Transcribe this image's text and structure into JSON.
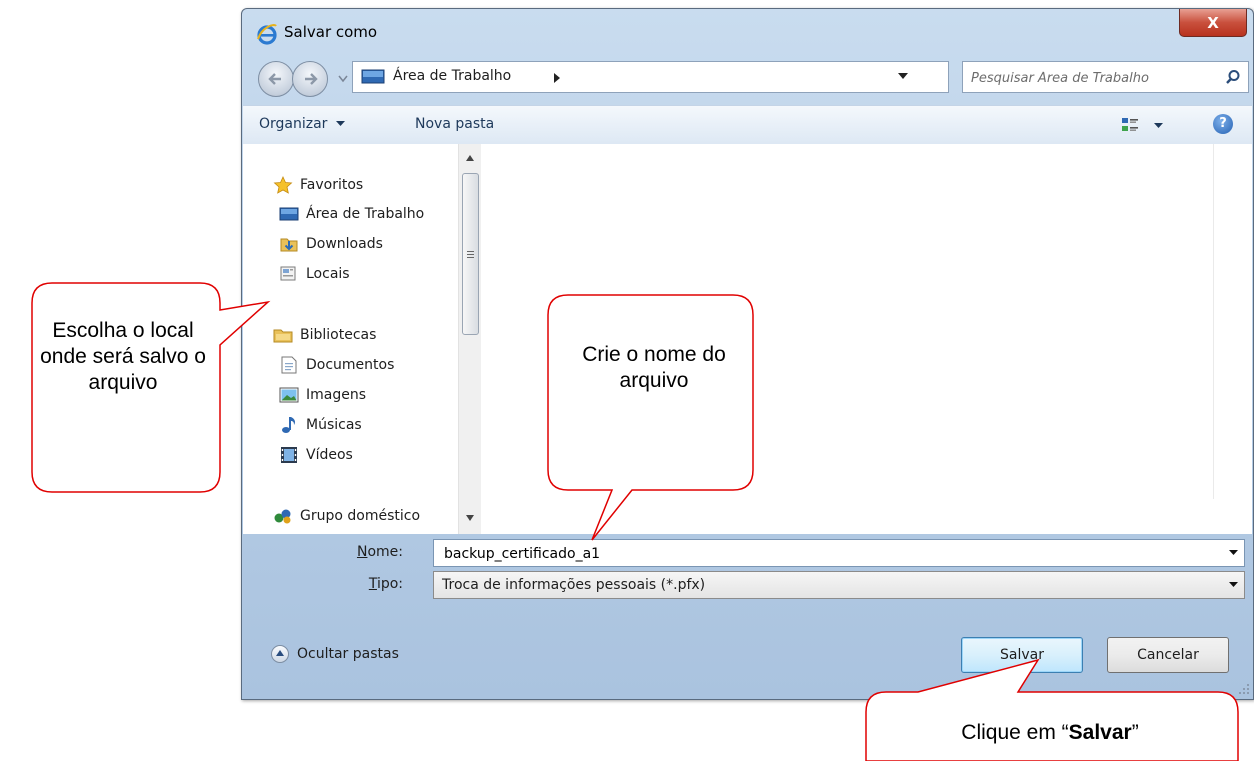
{
  "window": {
    "title": "Salvar como",
    "close_label": "X"
  },
  "address_bar": {
    "location": "Área de Trabalho",
    "search_placeholder": "Pesquisar Área de Trabalho"
  },
  "command_bar": {
    "organize_label": "Organizar",
    "new_folder_label": "Nova pasta",
    "help_label": "?"
  },
  "nav_pane": {
    "groups": [
      {
        "label": "Favoritos",
        "icon": "star-icon"
      },
      {
        "label": "Bibliotecas",
        "icon": "libraries-icon"
      },
      {
        "label": "Grupo doméstico",
        "icon": "homegroup-icon"
      }
    ],
    "favorites": [
      {
        "label": "Área de Trabalho",
        "icon": "desktop-icon"
      },
      {
        "label": "Downloads",
        "icon": "downloads-icon"
      },
      {
        "label": "Locais",
        "icon": "recent-places-icon"
      }
    ],
    "libraries": [
      {
        "label": "Documentos",
        "icon": "documents-icon"
      },
      {
        "label": "Imagens",
        "icon": "pictures-icon"
      },
      {
        "label": "Músicas",
        "icon": "music-icon"
      },
      {
        "label": "Vídeos",
        "icon": "videos-icon"
      }
    ]
  },
  "fields": {
    "name_label_u": "N",
    "name_label_rest": "ome:",
    "name_value": "backup_certificado_a1",
    "type_label_u": "T",
    "type_label_rest": "ipo:",
    "type_value": "Troca de informações pessoais (*.pfx)"
  },
  "footer": {
    "hide_folders_label": "Ocultar pastas",
    "save_label": "Salvar",
    "cancel_label": "Cancelar"
  },
  "callouts": {
    "location": "Escolha o local onde será salvo o arquivo",
    "filename": "Crie o nome do arquivo",
    "save_prefix": "Clique em “",
    "save_bold": "Salvar",
    "save_suffix": "”"
  },
  "colors": {
    "callout_border": "#e00000",
    "title_gradient": "#c9dcef",
    "close_button": "#c9503d"
  }
}
